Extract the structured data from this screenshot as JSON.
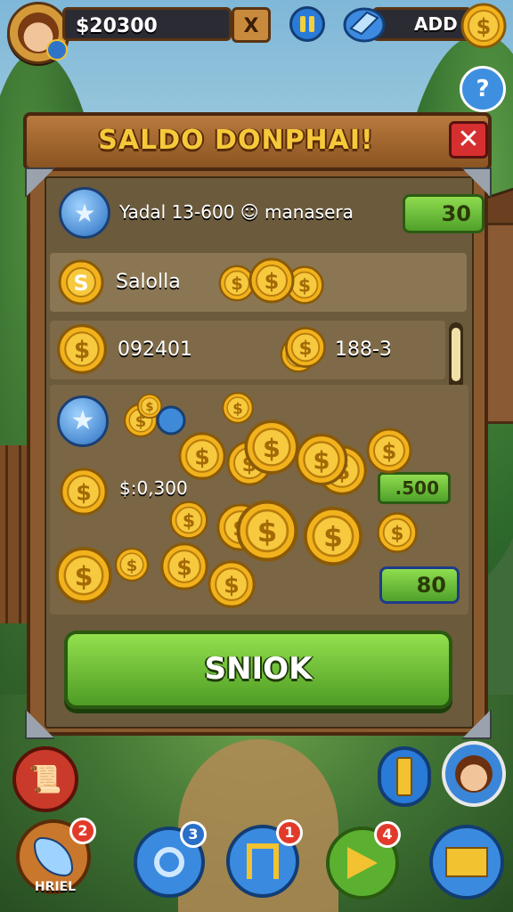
{
  "hud": {
    "money": "$20300",
    "money_close": "X",
    "add_label": "ADD",
    "help_icon": "?"
  },
  "dialog": {
    "title": "SALDO DONPHAI!",
    "close_label": "✕",
    "row1_text": "Yadal 13-600 ☺ manasera",
    "row1_badge": "30",
    "row2_text": "Salolla",
    "row3_left": "092401",
    "row3_right": "188-3",
    "amount_text": "$:0,300",
    "badge_500": ".500",
    "badge_80": "80",
    "ok_label": "SNIOK"
  },
  "bottom": {
    "weapon_label": "HRIEL",
    "badges": {
      "weapon": "2",
      "search": "3",
      "map": "1",
      "flag": "4"
    }
  },
  "colors": {
    "wood": "#8a5a2e",
    "title_gold": "#f6c93a",
    "green_button": "#5fb02e",
    "close_red": "#d62f2f",
    "blue_button": "#2a7ad8",
    "notif_red": "#e23a2a"
  },
  "icons": [
    "avatar",
    "pause-icon",
    "gem-icon",
    "coin-icon",
    "help-icon",
    "star-icon",
    "search-icon",
    "map-icon",
    "flag-icon",
    "mail-icon",
    "scroll-icon"
  ]
}
